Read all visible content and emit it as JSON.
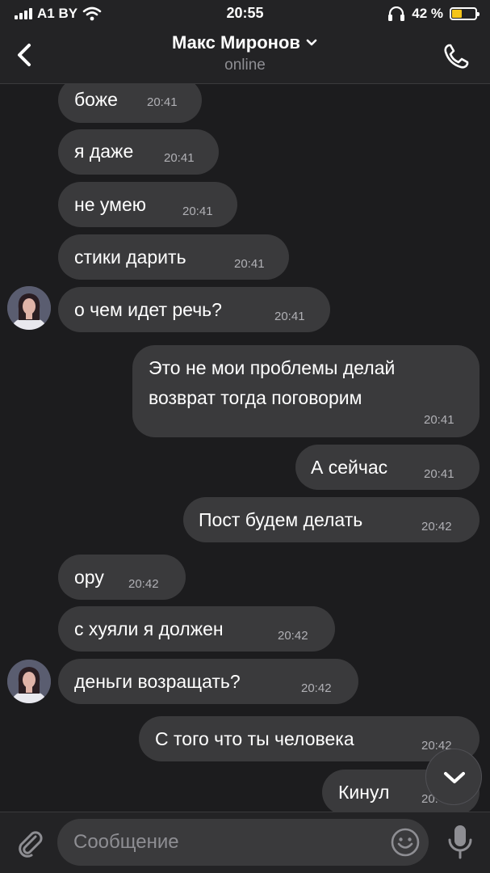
{
  "status_bar": {
    "carrier": "A1 BY",
    "time": "20:55",
    "battery": "42 %",
    "battery_level": 0.42
  },
  "header": {
    "contact_name": "Макс Миронов",
    "status": "online"
  },
  "messages": [
    {
      "text": "боже",
      "time": "20:41"
    },
    {
      "text": "я даже",
      "time": "20:41"
    },
    {
      "text": "не умею",
      "time": "20:41"
    },
    {
      "text": "стики дарить",
      "time": "20:41"
    },
    {
      "text": "о чем идет речь?",
      "time": "20:41"
    },
    {
      "text_line1": "Это не мои проблемы делай",
      "text_line2": "возврат тогда поговорим",
      "time": "20:41"
    },
    {
      "text": "А сейчас",
      "time": "20:41"
    },
    {
      "text": "Пост будем делать",
      "time": "20:42"
    },
    {
      "text": "ору",
      "time": "20:42"
    },
    {
      "text": "с хуяли я должен",
      "time": "20:42"
    },
    {
      "text": "деньги возращать?",
      "time": "20:42"
    },
    {
      "text": "С того что ты человека",
      "time": "20:42"
    },
    {
      "text": "Кинул",
      "time": "20:42"
    }
  ],
  "input": {
    "placeholder": "Сообщение",
    "value": ""
  },
  "colors": {
    "background": "#1c1c1e",
    "bubble": "#3a3a3c",
    "bar": "#232325",
    "battery": "#f5c518"
  },
  "icons": [
    "back-icon",
    "chevron-down-icon",
    "phone-icon",
    "paperclip-icon",
    "emoji-icon",
    "microphone-icon",
    "chevron-down-icon",
    "wifi-icon",
    "headphones-icon",
    "battery-icon",
    "signal-icon"
  ]
}
